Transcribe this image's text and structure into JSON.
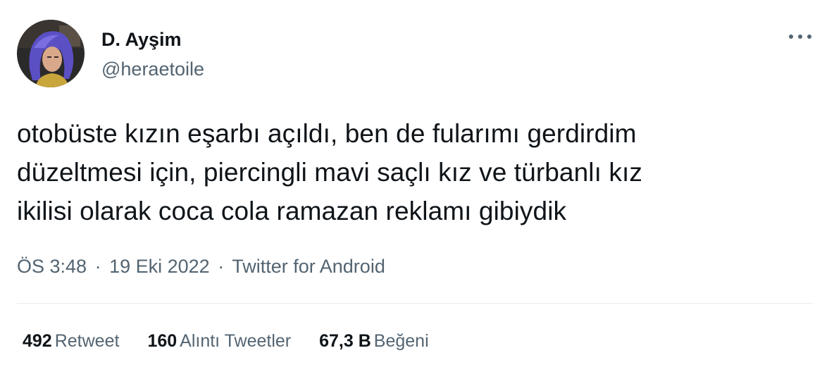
{
  "author": {
    "display_name": "D. Ayşim",
    "handle": "@heraetoile",
    "avatar_icon": "profile-photo"
  },
  "tweet": {
    "lines": [
      "otobüste kızın eşarbı açıldı, ben de fularımı gerdirdim",
      "düzeltmesi için, piercingli mavi saçlı kız ve türbanlı kız",
      "ikilisi olarak coca cola ramazan reklamı gibiydik"
    ]
  },
  "meta": {
    "time": "ÖS 3:48",
    "separator": "·",
    "date": "19 Eki 2022",
    "source": "Twitter for Android"
  },
  "stats": {
    "retweets": {
      "count": "492",
      "label": "Retweet"
    },
    "quotes": {
      "count": "160",
      "label": "Alıntı Tweetler"
    },
    "likes": {
      "count": "67,3 B",
      "label": "Beğeni"
    }
  },
  "colors": {
    "text": "#0f1419",
    "secondary": "#536471",
    "divider": "#e6ecf0"
  },
  "menu_icon": "more-horizontal-icon"
}
